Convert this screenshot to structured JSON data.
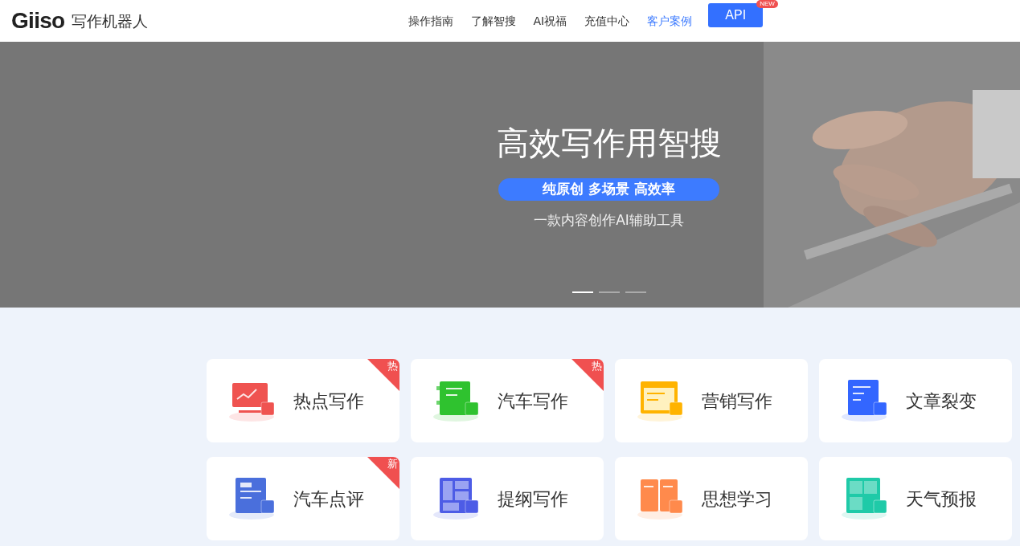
{
  "header": {
    "logo": "Giiso",
    "product": "写作机器人",
    "nav": [
      {
        "label": "操作指南",
        "selected": false
      },
      {
        "label": "了解智搜",
        "selected": false
      },
      {
        "label": "AI祝福",
        "selected": false
      },
      {
        "label": "充值中心",
        "selected": false
      },
      {
        "label": "客户案例",
        "selected": true
      }
    ],
    "api_button": {
      "label": "API",
      "badge": "NEW"
    }
  },
  "banner": {
    "kind": "picture",
    "title": "高效写作用智搜",
    "tagline": "纯原创 多场景 高效率",
    "subtitle": "一款内容创作AI辅助工具",
    "dots": [
      {
        "selected": true
      },
      {
        "selected": false
      },
      {
        "selected": false
      }
    ]
  },
  "cards": [
    {
      "label": "热点写作",
      "kind": "chart",
      "color": "#ef5350",
      "badge": "热"
    },
    {
      "label": "汽车写作",
      "kind": "form",
      "color": "#2fc22f",
      "badge": "热"
    },
    {
      "label": "营销写作",
      "kind": "browser",
      "color": "#ffb300"
    },
    {
      "label": "文章裂变",
      "kind": "document",
      "color": "#3366ff"
    },
    {
      "label": "汽车点评",
      "kind": "review",
      "color": "#4a6fdc",
      "badge": "新"
    },
    {
      "label": "提纲写作",
      "kind": "outline",
      "color": "#4d5ce6"
    },
    {
      "label": "思想学习",
      "kind": "book",
      "color": "#ff8a4c"
    },
    {
      "label": "天气预报",
      "kind": "weather",
      "color": "#1fcaa8"
    }
  ]
}
